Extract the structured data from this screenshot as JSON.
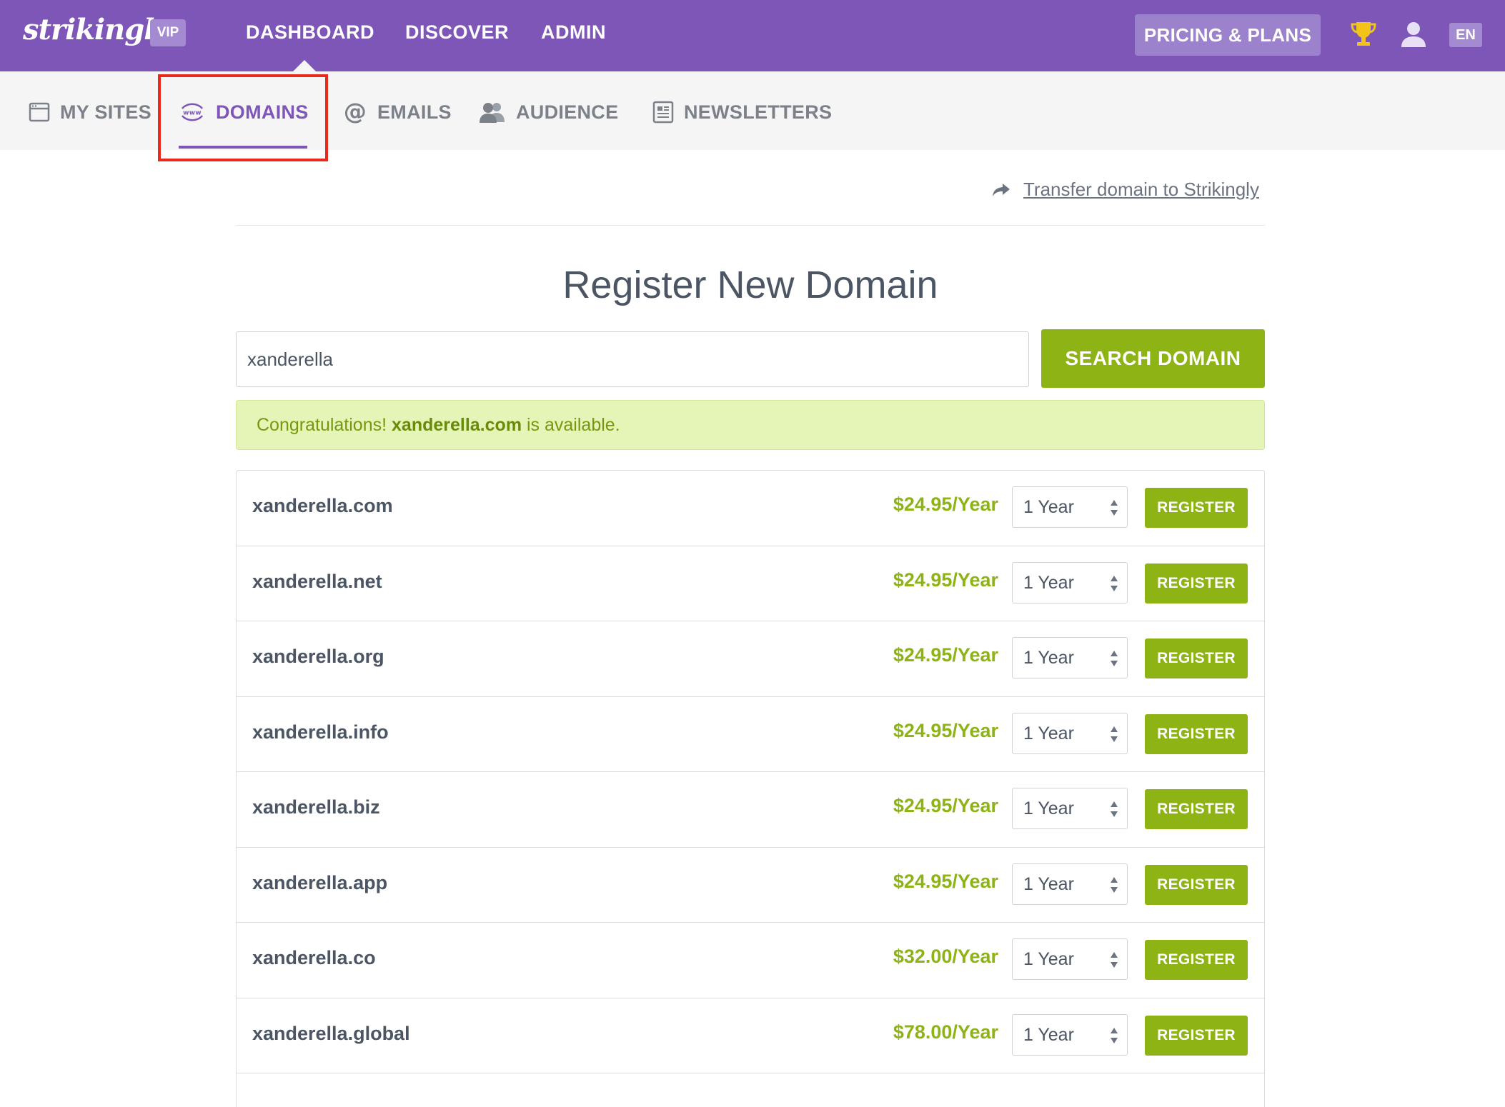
{
  "header": {
    "logo": "strikingly",
    "vip_badge": "VIP",
    "nav": [
      "DASHBOARD",
      "DISCOVER",
      "ADMIN"
    ],
    "pricing_button": "PRICING & PLANS",
    "language": "EN"
  },
  "subnav": {
    "items": [
      "MY SITES",
      "DOMAINS",
      "EMAILS",
      "AUDIENCE",
      "NEWSLETTERS"
    ],
    "active": "DOMAINS"
  },
  "transfer_link": "Transfer domain to Strikingly",
  "page_title": "Register New Domain",
  "search": {
    "value": "xanderella",
    "button": "SEARCH DOMAIN"
  },
  "alert": {
    "prefix": "Congratulations!",
    "domain": "xanderella.com",
    "suffix": "is available."
  },
  "domains": [
    {
      "name": "xanderella.com",
      "price": "$24.95/Year",
      "term": "1 Year",
      "action": "REGISTER"
    },
    {
      "name": "xanderella.net",
      "price": "$24.95/Year",
      "term": "1 Year",
      "action": "REGISTER"
    },
    {
      "name": "xanderella.org",
      "price": "$24.95/Year",
      "term": "1 Year",
      "action": "REGISTER"
    },
    {
      "name": "xanderella.info",
      "price": "$24.95/Year",
      "term": "1 Year",
      "action": "REGISTER"
    },
    {
      "name": "xanderella.biz",
      "price": "$24.95/Year",
      "term": "1 Year",
      "action": "REGISTER"
    },
    {
      "name": "xanderella.app",
      "price": "$24.95/Year",
      "term": "1 Year",
      "action": "REGISTER"
    },
    {
      "name": "xanderella.co",
      "price": "$32.00/Year",
      "term": "1 Year",
      "action": "REGISTER"
    },
    {
      "name": "xanderella.global",
      "price": "$78.00/Year",
      "term": "1 Year",
      "action": "REGISTER"
    }
  ],
  "icons": [
    "trophy-icon",
    "user-icon",
    "calendar-icon",
    "www-icon",
    "at-icon",
    "audience-icon",
    "newsletter-icon",
    "share-arrow-icon",
    "select-arrows-icon"
  ],
  "colors": {
    "brand_purple": "#7e56b8",
    "accent_green": "#8db314",
    "alert_background": "#e5f5b8",
    "highlight_red": "#e8291c"
  }
}
